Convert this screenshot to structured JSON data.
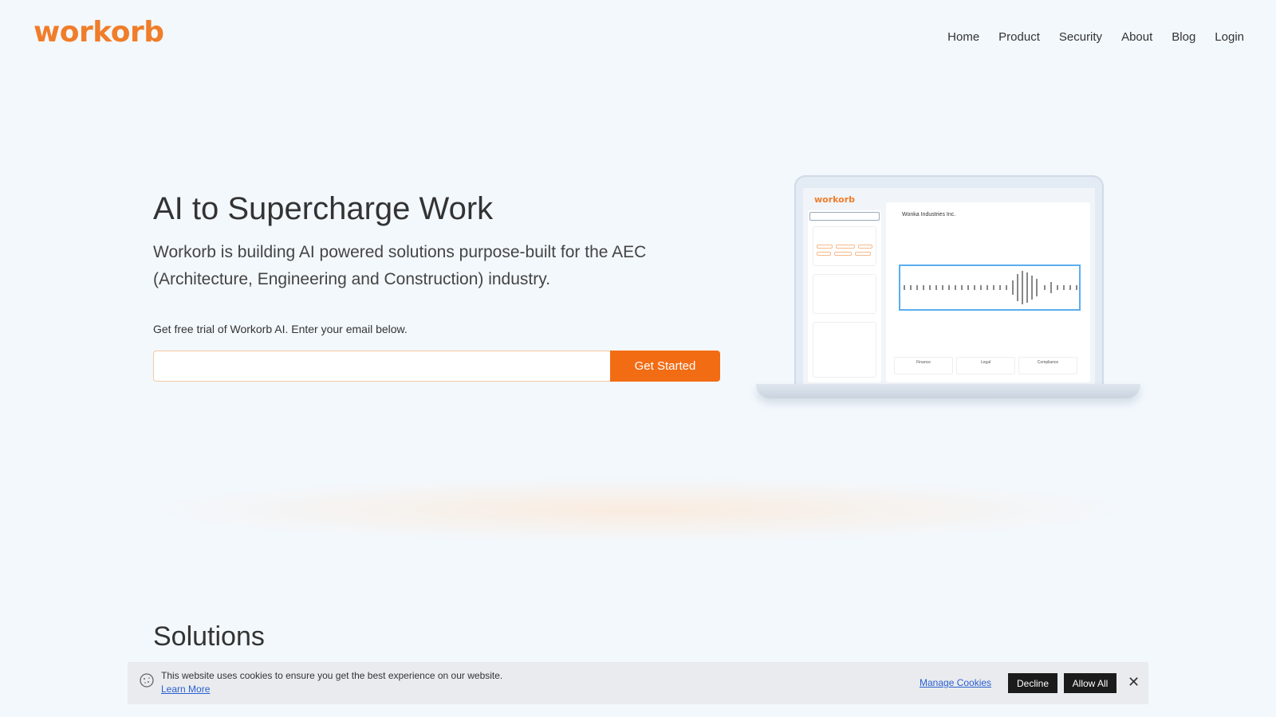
{
  "header": {
    "logo_text": "workorb",
    "nav": [
      "Home",
      "Product",
      "Security",
      "About",
      "Blog",
      "Login"
    ]
  },
  "hero": {
    "title": "AI to Supercharge Work",
    "subtitle": "Workorb is building AI powered solutions purpose-built for the AEC (Architecture, Engineering and Construction) industry.",
    "trial_text": "Get free trial of Workorb AI. Enter your email below.",
    "email_placeholder": "",
    "cta_label": "Get Started"
  },
  "preview": {
    "logo_text": "workorb",
    "company": "Wonka Industries Inc.",
    "cards": [
      "Finance",
      "Legal",
      "Compliance"
    ]
  },
  "sections": {
    "solutions_title": "Solutions"
  },
  "cookie": {
    "text": "This website uses cookies to ensure you get the best experience on our website.",
    "learn_more": "Learn More",
    "manage": "Manage Cookies",
    "decline": "Decline",
    "allow": "Allow All",
    "close": "✕"
  },
  "colors": {
    "brand": "#f07d2a",
    "cta": "#f26c14",
    "background": "#f3f8fd"
  }
}
